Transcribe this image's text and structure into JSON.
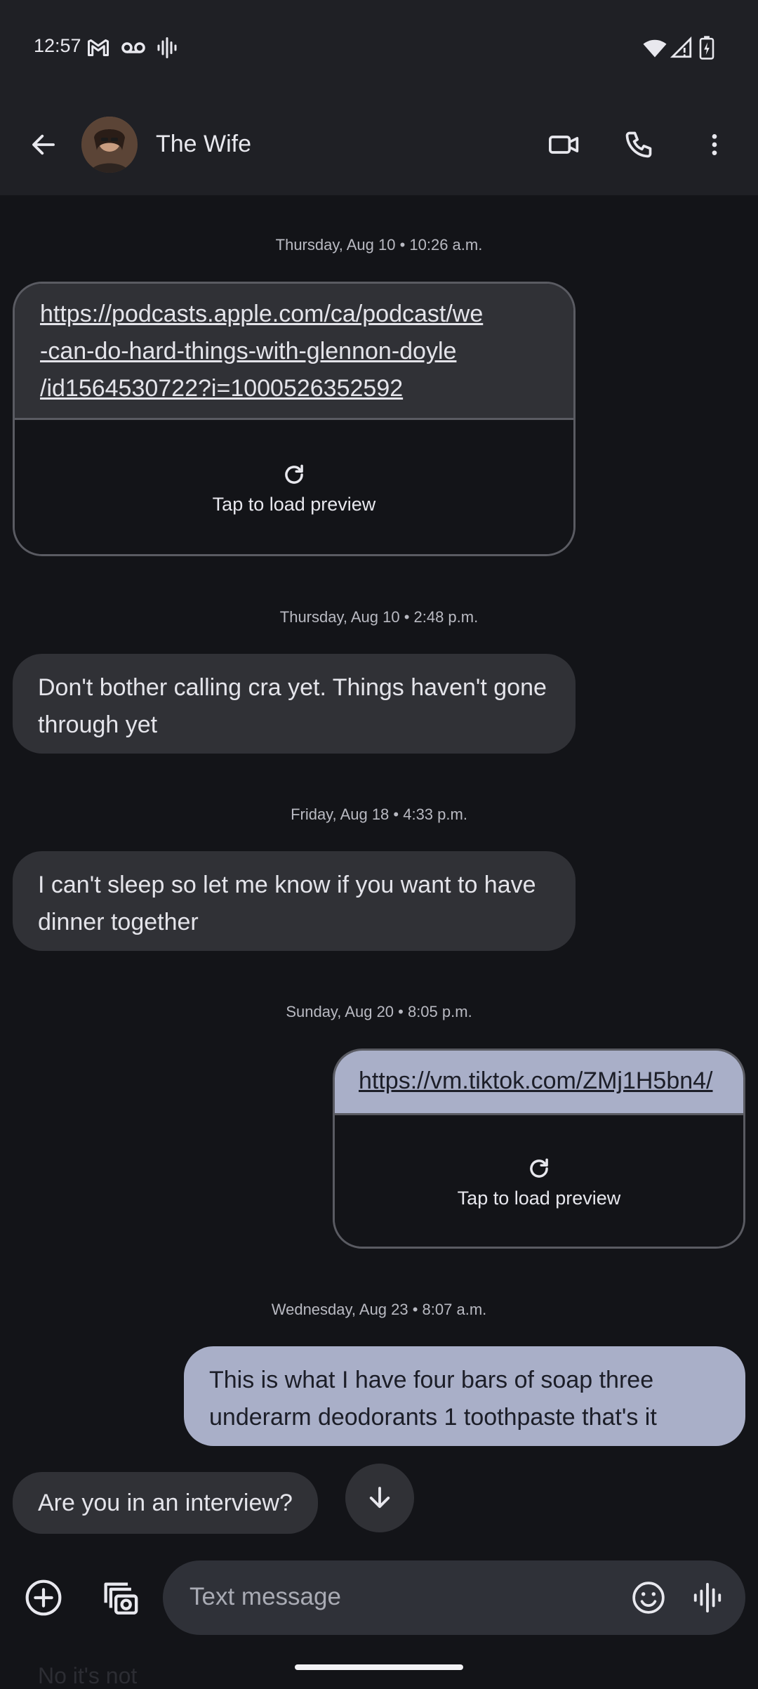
{
  "status_bar": {
    "time": "12:57",
    "left_icons": [
      "gmail-icon",
      "voicemail-icon",
      "sound-wave-icon"
    ],
    "right_icons": [
      "wifi-icon",
      "signal-icon",
      "battery-charging-icon"
    ]
  },
  "header": {
    "contact_name": "The Wife",
    "back_icon": "arrow-left-icon",
    "actions": [
      "video-call-icon",
      "phone-icon",
      "more-vertical-icon"
    ]
  },
  "messages": [
    {
      "timestamp": "Thursday, Aug 10 • 10:26 a.m.",
      "direction": "incoming",
      "type": "link",
      "url": "https://podcasts.apple.com/ca/podcast/we-can-do-hard-things-with-glennon-doyle/id1564530722?i=1000526352592",
      "url_lines": [
        "https://podcasts.apple.com/ca/podcast/we",
        "-can-do-hard-things-with-glennon-doyle",
        "/id1564530722?i=1000526352592"
      ],
      "preview_label": "Tap to load preview"
    },
    {
      "timestamp": "Thursday, Aug 10 • 2:48 p.m.",
      "direction": "incoming",
      "type": "text",
      "text": "Don't bother calling cra yet. Things haven't gone through yet"
    },
    {
      "timestamp": "Friday, Aug 18 • 4:33 p.m.",
      "direction": "incoming",
      "type": "text",
      "text": "I can't sleep so let me know if you want to have dinner together"
    },
    {
      "timestamp": "Sunday, Aug 20 • 8:05 p.m.",
      "direction": "outgoing",
      "type": "link",
      "url": "https://vm.tiktok.com/ZMj1H5bn4/",
      "preview_label": "Tap to load preview"
    },
    {
      "timestamp": "Wednesday, Aug 23 • 8:07 a.m.",
      "direction": "outgoing",
      "type": "text",
      "text": "This is what I have four bars of soap three underarm deodorants 1 toothpaste that's it"
    },
    {
      "direction": "incoming",
      "type": "text",
      "text": "Are you in an interview?"
    }
  ],
  "compose": {
    "placeholder": "Text message",
    "left_icons": [
      "add-circle-icon",
      "gallery-camera-icon"
    ],
    "right_icons": [
      "emoji-icon",
      "voice-message-icon"
    ]
  },
  "partial_hidden_text": "No it's not",
  "colors": {
    "background": "#131418",
    "bar_background": "#1f2025",
    "incoming_bubble": "#303136",
    "outgoing_bubble": "#a9afc8"
  }
}
